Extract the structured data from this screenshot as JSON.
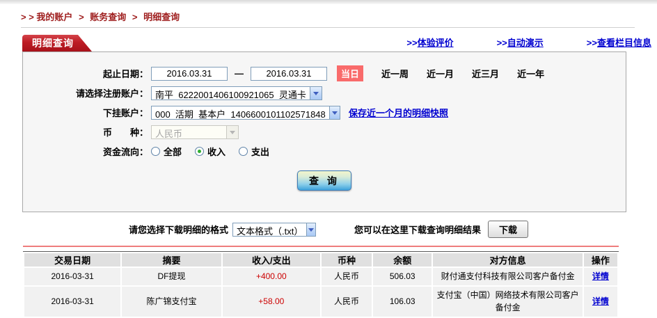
{
  "breadcrumb": {
    "prefix": "> >",
    "separator": ">",
    "items": [
      "我的账户",
      "账务查询",
      "明细查询"
    ]
  },
  "tab": {
    "title": "明细查询"
  },
  "links": {
    "prefix": ">>",
    "items": [
      "体验评价",
      "自动演示",
      "查看栏目信息"
    ]
  },
  "form": {
    "date_range": {
      "label": "起止日期：",
      "start_value": "2016.03.31",
      "end_value": "2016.03.31",
      "separator": "—",
      "quick_options": [
        "当日",
        "近一周",
        "近一月",
        "近三月",
        "近一年"
      ],
      "active_option": "当日"
    },
    "register_account": {
      "label": "请选择注册账户：",
      "value": "南平  6222001406100921065  灵通卡"
    },
    "sub_account": {
      "label": "下挂账户：",
      "value": "000  活期  基本户  1406600101102571848",
      "snapshot_link": "保存近一个月的明细快照"
    },
    "currency": {
      "label": "币　　种：",
      "value": "人民币",
      "disabled": true
    },
    "fund_flow": {
      "label": "资金流向：",
      "options": [
        {
          "label": "全部",
          "checked": false
        },
        {
          "label": "收入",
          "checked": true
        },
        {
          "label": "支出",
          "checked": false
        }
      ]
    },
    "query_button": "查 询"
  },
  "download": {
    "format_label": "请您选择下载明细的格式",
    "format_value": "文本格式（.txt）",
    "hint": "您可以在这里下载查询明细结果",
    "button": "下载"
  },
  "table": {
    "headers": [
      "交易日期",
      "摘要",
      "收入/支出",
      "币种",
      "余额",
      "对方信息",
      "操作"
    ],
    "rows": [
      {
        "date": "2016-03-31",
        "summary": "DF提现",
        "amount": "+400.00",
        "currency": "人民币",
        "balance": "506.03",
        "counterparty": "财付通支付科技有限公司客户备付金",
        "action": "详情"
      },
      {
        "date": "2016-03-31",
        "summary": "陈广锦支付宝",
        "amount": "+58.00",
        "currency": "人民币",
        "balance": "106.03",
        "counterparty": "支付宝（中国）网络技术有限公司客户备付金",
        "action": "详情"
      }
    ]
  },
  "colors": {
    "brand_red": "#b51920",
    "breadcrumb_red": "#9e1c1c",
    "link_blue": "#0000d0",
    "amount_red": "#cc0000",
    "active_day_bg": "#f96b6b",
    "divider_salmon": "#ee7d7d"
  }
}
